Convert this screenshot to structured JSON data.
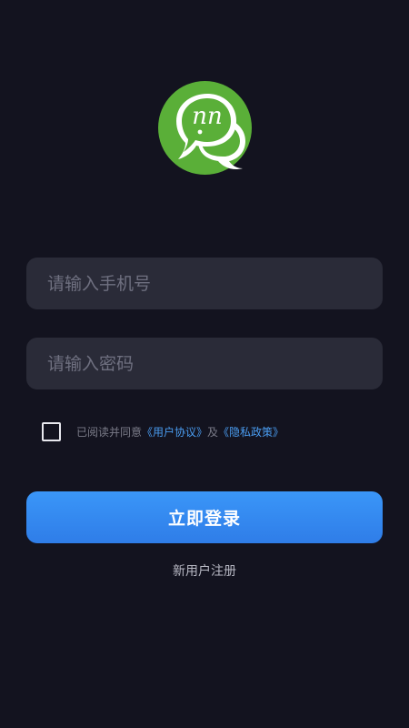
{
  "logo": {
    "icon": "chat-bubble-logo",
    "colors": {
      "primary": "#5aaf38",
      "dark": "#3f9a24",
      "bubble": "#ffffff"
    }
  },
  "form": {
    "phone_placeholder": "请输入手机号",
    "password_placeholder": "请输入密码"
  },
  "agreement": {
    "prefix": "已阅读并同意",
    "user_agreement": "《用户协议》",
    "conjunction": "及",
    "privacy_policy": "《隐私政策》",
    "checked": false
  },
  "actions": {
    "login_label": "立即登录",
    "register_label": "新用户注册"
  },
  "colors": {
    "background": "#13131f",
    "field": "#2a2b38",
    "accent": "#3a8ef5",
    "link": "#4a9cf0"
  }
}
